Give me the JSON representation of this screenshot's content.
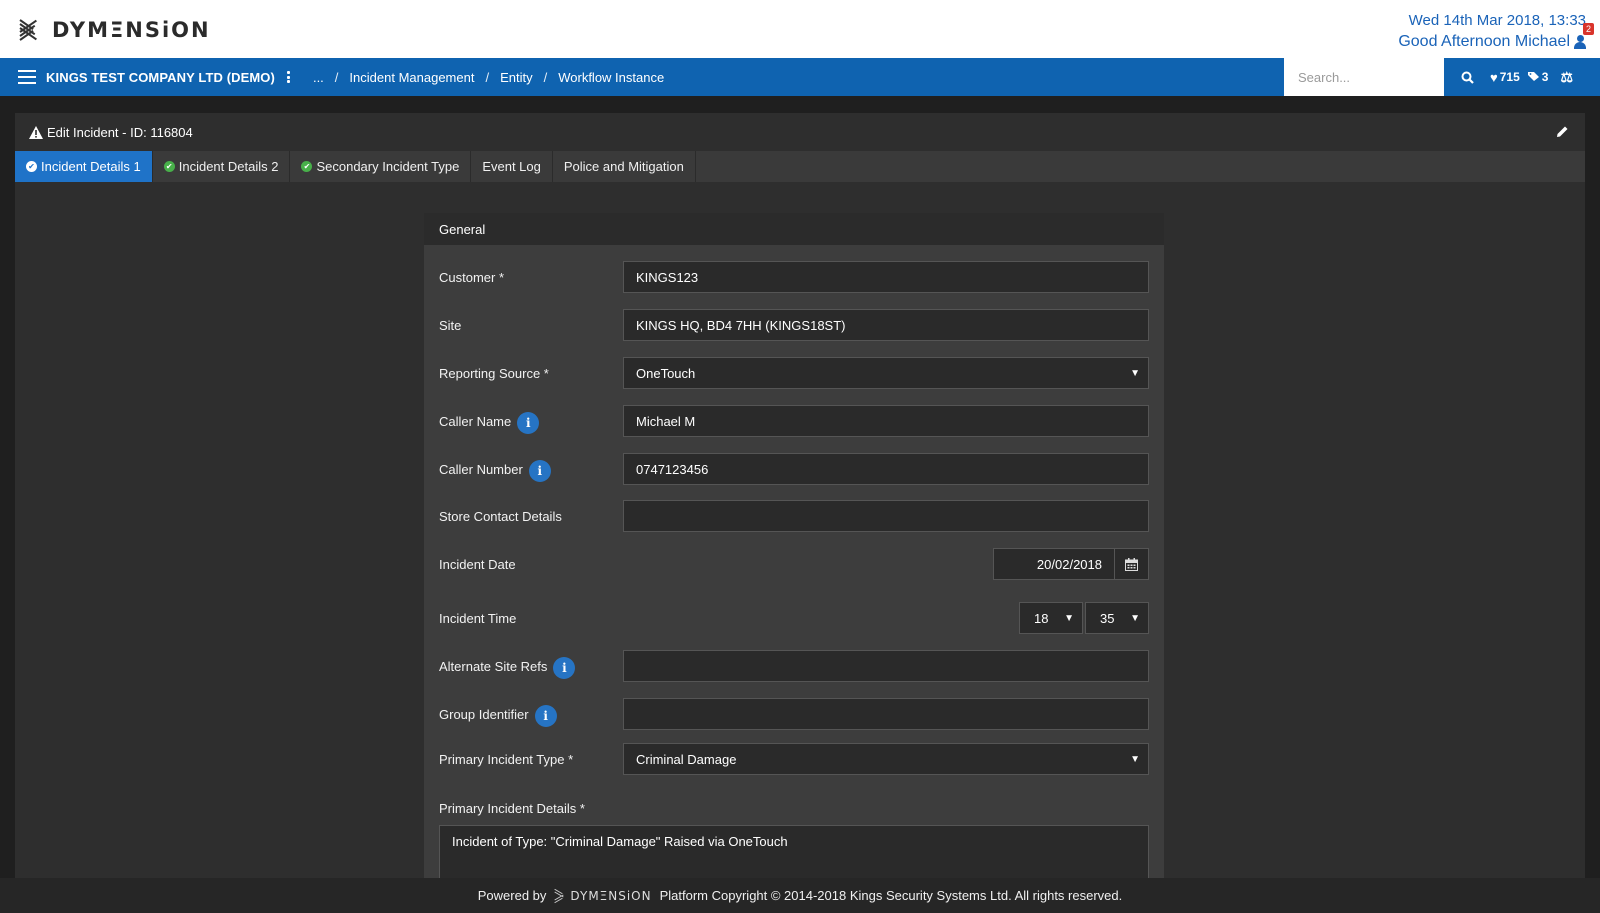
{
  "header": {
    "logo_text": "DYMΞNSiON",
    "datetime": "Wed 14th Mar 2018, 13:33",
    "greeting": "Good Afternoon Michael",
    "notification_count": "2"
  },
  "nav": {
    "company": "KINGS TEST COMPANY LTD (DEMO)",
    "breadcrumb": [
      "...",
      "Incident Management",
      "Entity",
      "Workflow Instance"
    ],
    "search_placeholder": "Search...",
    "favourites_count": "715",
    "tags_count": "3"
  },
  "panel": {
    "title": "Edit Incident - ID: 116804",
    "tabs": [
      {
        "label": "Incident Details 1",
        "status": "complete-active"
      },
      {
        "label": "Incident Details 2",
        "status": "complete"
      },
      {
        "label": "Secondary Incident Type",
        "status": "complete"
      },
      {
        "label": "Event Log",
        "status": "none"
      },
      {
        "label": "Police and Mitigation",
        "status": "none"
      }
    ]
  },
  "form": {
    "section_title": "General",
    "fields": {
      "customer": {
        "label": "Customer *",
        "value": "KINGS123"
      },
      "site": {
        "label": "Site",
        "value": "KINGS HQ, BD4 7HH (KINGS18ST)"
      },
      "reporting_source": {
        "label": "Reporting Source *",
        "value": "OneTouch"
      },
      "caller_name": {
        "label": "Caller Name",
        "value": "Michael M"
      },
      "caller_number": {
        "label": "Caller Number",
        "value": "0747123456"
      },
      "store_contact": {
        "label": "Store Contact Details",
        "value": ""
      },
      "incident_date": {
        "label": "Incident Date",
        "value": "20/02/2018"
      },
      "incident_time": {
        "label": "Incident Time",
        "hour": "18",
        "minute": "35"
      },
      "alternate_site_refs": {
        "label": "Alternate Site Refs",
        "value": ""
      },
      "group_identifier": {
        "label": "Group Identifier",
        "value": ""
      },
      "primary_incident_type": {
        "label": "Primary Incident Type *",
        "value": "Criminal Damage"
      },
      "primary_incident_details": {
        "label": "Primary Incident Details *",
        "value": "Incident of Type: \"Criminal Damage\"  Raised via OneTouch"
      }
    }
  },
  "footer": {
    "powered_by": "Powered by",
    "logo_text": "DYMΞNSiON",
    "copyright": "Platform Copyright © 2014-2018 Kings Security Systems Ltd. All rights reserved."
  },
  "colors": {
    "brand_blue": "#0f63b0",
    "active_tab": "#1f73c8",
    "check_green": "#48b04a",
    "info_blue": "#2674c4"
  }
}
